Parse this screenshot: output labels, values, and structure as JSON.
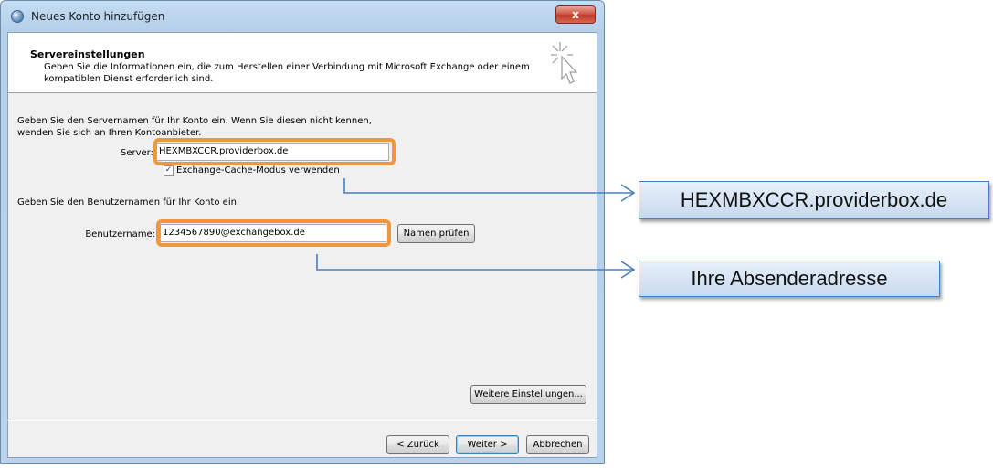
{
  "window": {
    "title": "Neues Konto hinzufügen",
    "close_label": "x"
  },
  "header": {
    "title": "Servereinstellungen",
    "description": "Geben Sie die Informationen ein, die zum Herstellen einer Verbindung mit Microsoft Exchange oder einem kompatiblen Dienst erforderlich sind."
  },
  "server_section": {
    "instruction": "Geben Sie den Servernamen für Ihr Konto ein. Wenn Sie diesen nicht kennen, wenden Sie sich an Ihren Kontoanbieter.",
    "server_label": "Server:",
    "server_value": "HEXMBXCCR.providerbox.de",
    "cache_mode_label": "Exchange-Cache-Modus verwenden",
    "cache_mode_checked": true
  },
  "user_section": {
    "instruction": "Geben Sie den Benutzernamen für Ihr Konto ein.",
    "username_label": "Benutzername:",
    "username_value": "1234567890@exchangebox.de",
    "check_names_button": "Namen prüfen"
  },
  "more_settings_button": "Weitere Einstellungen...",
  "footer": {
    "back_button": "< Zurück",
    "next_button": "Weiter >",
    "cancel_button": "Abbrechen"
  },
  "annotations": {
    "server_callout": "HEXMBXCCR.providerbox.de",
    "sender_callout": "Ihre Absenderadresse",
    "highlight_color": "#f0963c",
    "connector_color": "#4a7fbc"
  }
}
